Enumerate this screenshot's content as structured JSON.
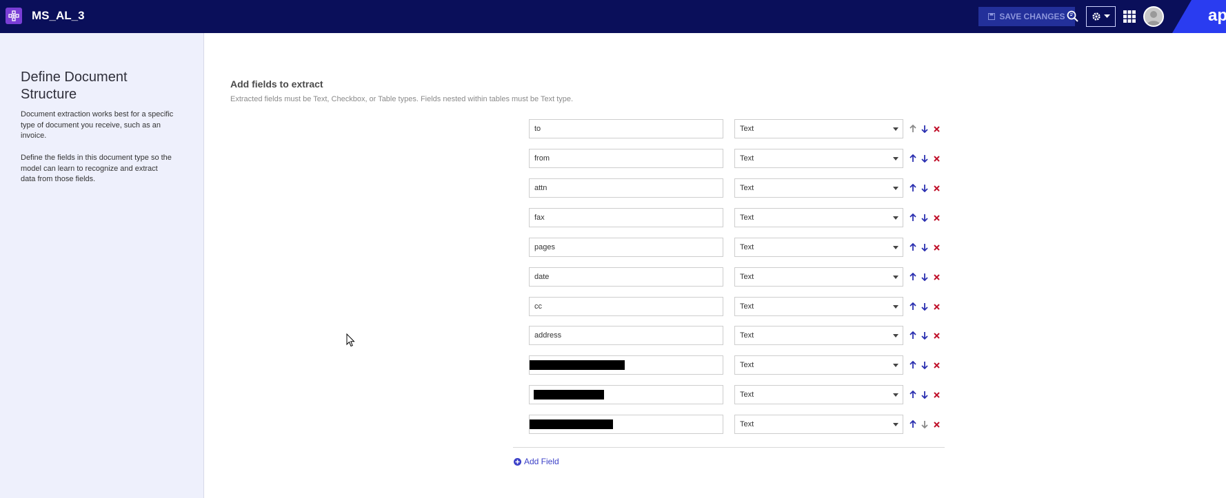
{
  "header": {
    "app_title": "MS_AL_3",
    "save_label": "SAVE CHANGES",
    "brand_text": "ap"
  },
  "sidebar": {
    "title": "Define Document Structure",
    "paragraph1": "Document extraction works best for a specific type of document you receive, such as an invoice.",
    "paragraph2": "Define the fields in this document type so the model can learn to recognize and extract data from those fields."
  },
  "main": {
    "title": "Add fields to extract",
    "subtitle": "Extracted fields must be Text, Checkbox, or Table types. Fields nested within tables must be Text type.",
    "fields": [
      {
        "name": "to",
        "type": "Text"
      },
      {
        "name": "from",
        "type": "Text"
      },
      {
        "name": "attn",
        "type": "Text"
      },
      {
        "name": "fax",
        "type": "Text"
      },
      {
        "name": "pages",
        "type": "Text"
      },
      {
        "name": "date",
        "type": "Text"
      },
      {
        "name": "cc",
        "type": "Text"
      },
      {
        "name": "address",
        "type": "Text"
      },
      {
        "name": "",
        "type": "Text"
      },
      {
        "name": "",
        "type": "Text"
      },
      {
        "name": "",
        "type": "Text"
      }
    ],
    "add_field_label": "Add Field"
  },
  "colors": {
    "topbar": "#0a0f5a",
    "accent": "#3a3fc7",
    "delete": "#c0102a",
    "sidebar_bg": "#eef0fc"
  }
}
